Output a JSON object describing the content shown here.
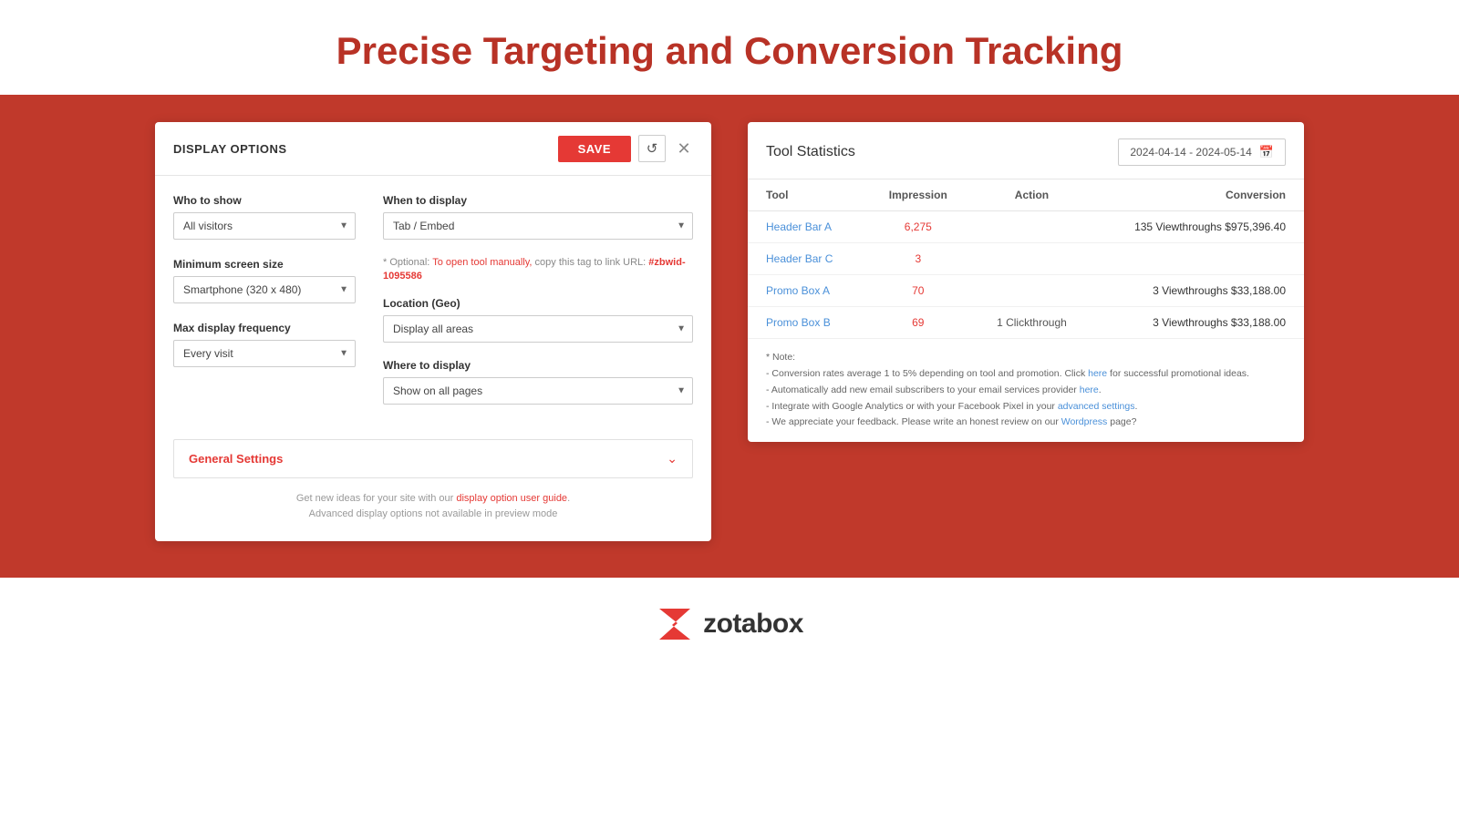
{
  "header": {
    "title": "Precise Targeting and Conversion Tracking"
  },
  "display_panel": {
    "title": "DISPLAY OPTIONS",
    "save_label": "SAVE",
    "refresh_icon": "↺",
    "close_icon": "✕",
    "who_to_show": {
      "label": "Who to show",
      "options": [
        "All visitors"
      ],
      "selected": "All visitors"
    },
    "min_screen_size": {
      "label": "Minimum screen size",
      "options": [
        "Smartphone (320 x 480)"
      ],
      "selected": "Smartphone (320 x 480)"
    },
    "max_display_freq": {
      "label": "Max display frequency",
      "options": [
        "Every visit"
      ],
      "selected": "Every visit"
    },
    "when_to_display": {
      "label": "When to display",
      "options": [
        "Tab / Embed"
      ],
      "selected": "Tab / Embed"
    },
    "optional_note": "* Optional: To open tool manually, copy this tag to link URL: #zbwid-1095586",
    "to_open_label": "To open tool manually,",
    "tag_value": "#zbwid-1095586",
    "location_geo": {
      "label": "Location (Geo)",
      "options": [
        "Display all areas"
      ],
      "selected": "Display all areas"
    },
    "where_to_display": {
      "label": "Where to display",
      "options": [
        "Show on all pages"
      ],
      "selected": "Show on all pages"
    },
    "general_settings_label": "General Settings",
    "footer_text1": "Get new ideas for your site with our",
    "footer_link1": "display option user guide",
    "footer_text2": ".",
    "footer_text3": "Advanced display options not available in preview mode"
  },
  "stats_panel": {
    "title": "Tool Statistics",
    "date_range": "2024-04-14 - 2024-05-14",
    "columns": {
      "tool": "Tool",
      "impression": "Impression",
      "action": "Action",
      "conversion": "Conversion"
    },
    "rows": [
      {
        "tool": "Header Bar A",
        "impression": "6,275",
        "action": "",
        "conversion": "135 Viewthroughs $975,396.40"
      },
      {
        "tool": "Header Bar C",
        "impression": "3",
        "action": "",
        "conversion": ""
      },
      {
        "tool": "Promo Box A",
        "impression": "70",
        "action": "",
        "conversion": "3 Viewthroughs $33,188.00"
      },
      {
        "tool": "Promo Box B",
        "impression": "69",
        "action": "1 Clickthrough",
        "conversion": "3 Viewthroughs $33,188.00"
      }
    ],
    "notes": [
      "* Note:",
      "- Conversion rates average 1 to 5% depending on tool and promotion. Click here for successful promotional ideas.",
      "- Automatically add new email subscribers to your email services provider here.",
      "- Integrate with Google Analytics or with your Facebook Pixel in your advanced settings.",
      "- We appreciate your feedback. Please write an honest review on our Wordpress page?"
    ],
    "note_links": {
      "here1": "here",
      "here2": "here",
      "advanced_settings": "advanced settings",
      "wordpress": "Wordpress"
    }
  },
  "footer": {
    "brand_name": "zotabox"
  }
}
